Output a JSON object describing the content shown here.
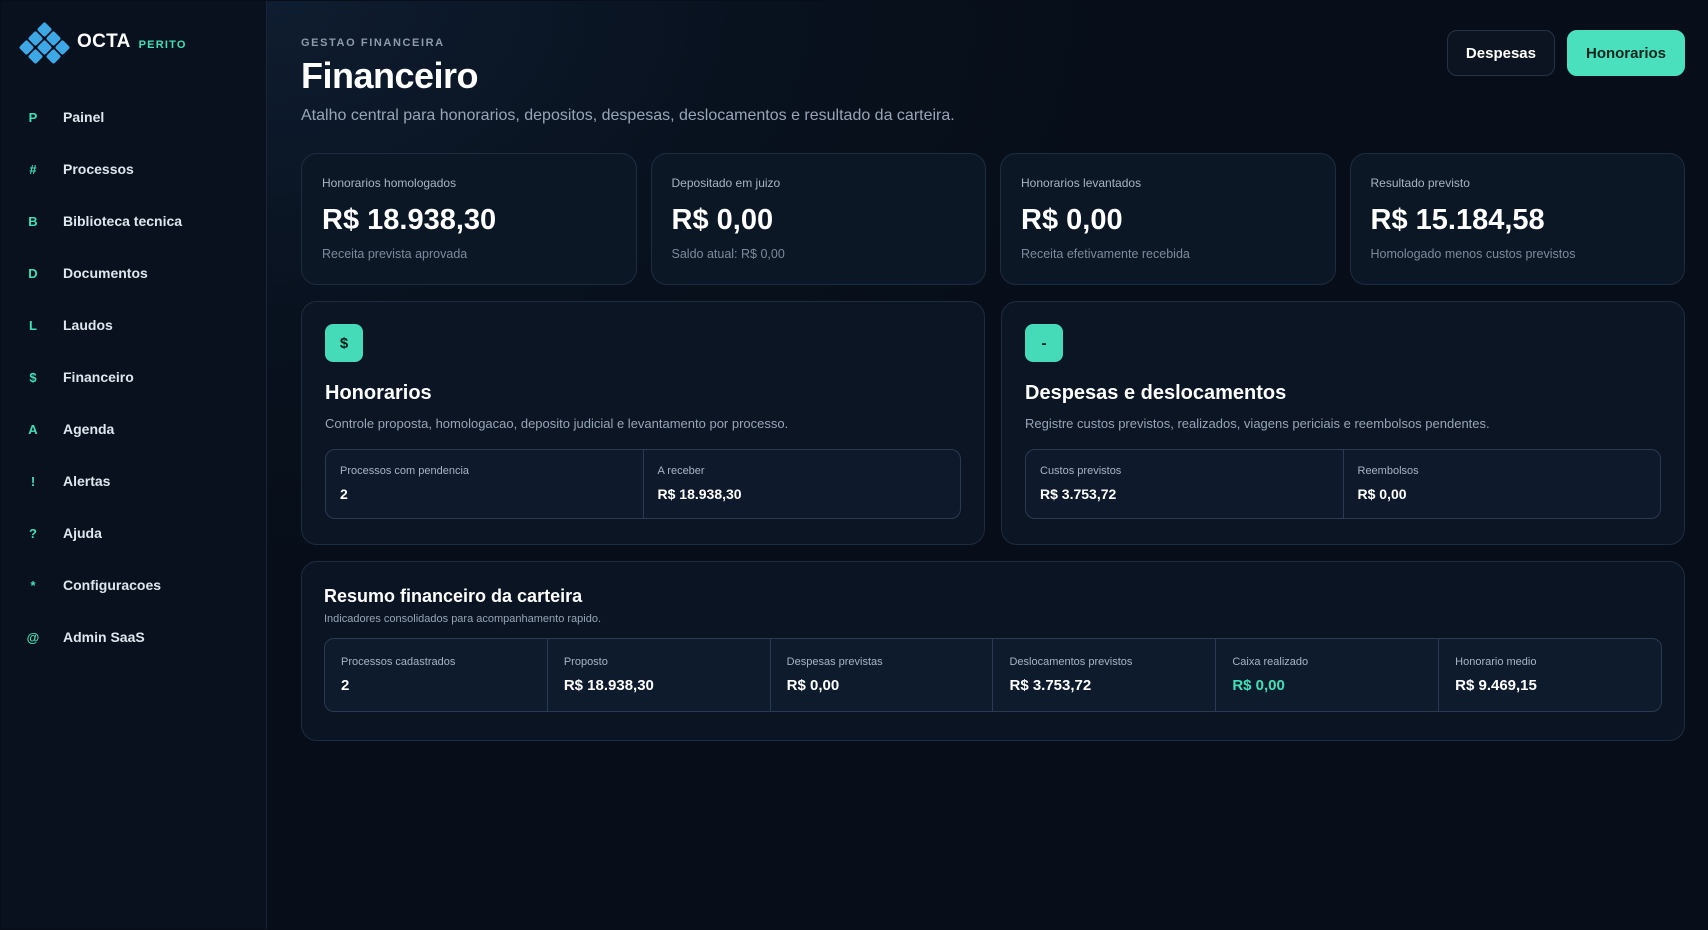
{
  "brand": {
    "name": "OCTA",
    "tag": "PERITO"
  },
  "sidebar": {
    "items": [
      {
        "icon": "P",
        "label": "Painel"
      },
      {
        "icon": "#",
        "label": "Processos"
      },
      {
        "icon": "B",
        "label": "Biblioteca tecnica"
      },
      {
        "icon": "D",
        "label": "Documentos"
      },
      {
        "icon": "L",
        "label": "Laudos"
      },
      {
        "icon": "$",
        "label": "Financeiro"
      },
      {
        "icon": "A",
        "label": "Agenda"
      },
      {
        "icon": "!",
        "label": "Alertas"
      },
      {
        "icon": "?",
        "label": "Ajuda"
      },
      {
        "icon": "*",
        "label": "Configuracoes"
      },
      {
        "icon": "@",
        "label": "Admin SaaS"
      }
    ]
  },
  "header": {
    "eyebrow": "GESTAO FINANCEIRA",
    "title": "Financeiro",
    "subtitle": "Atalho central para honorarios, depositos, despesas, deslocamentos e resultado da carteira.",
    "buttons": {
      "expenses": "Despesas",
      "fees": "Honorarios"
    }
  },
  "stats": [
    {
      "label": "Honorarios homologados",
      "value": "R$ 18.938,30",
      "note": "Receita prevista aprovada"
    },
    {
      "label": "Depositado em juizo",
      "value": "R$ 0,00",
      "note": "Saldo atual: R$ 0,00"
    },
    {
      "label": "Honorarios levantados",
      "value": "R$ 0,00",
      "note": "Receita efetivamente recebida"
    },
    {
      "label": "Resultado previsto",
      "value": "R$ 15.184,58",
      "note": "Homologado menos custos previstos"
    }
  ],
  "panels": {
    "fees": {
      "icon": "$",
      "title": "Honorarios",
      "description": "Controle proposta, homologacao, deposito judicial e levantamento por processo.",
      "metrics": [
        {
          "label": "Processos com pendencia",
          "value": "2"
        },
        {
          "label": "A receber",
          "value": "R$ 18.938,30"
        }
      ]
    },
    "expenses": {
      "icon": "-",
      "title": "Despesas e deslocamentos",
      "description": "Registre custos previstos, realizados, viagens periciais e reembolsos pendentes.",
      "metrics": [
        {
          "label": "Custos previstos",
          "value": "R$ 3.753,72"
        },
        {
          "label": "Reembolsos",
          "value": "R$ 0,00"
        }
      ]
    }
  },
  "summary": {
    "title": "Resumo financeiro da carteira",
    "subtitle": "Indicadores consolidados para acompanhamento rapido.",
    "cells": [
      {
        "label": "Processos cadastrados",
        "value": "2"
      },
      {
        "label": "Proposto",
        "value": "R$ 18.938,30"
      },
      {
        "label": "Despesas previstas",
        "value": "R$ 0,00"
      },
      {
        "label": "Deslocamentos previstos",
        "value": "R$ 3.753,72"
      },
      {
        "label": "Caixa realizado",
        "value": "R$ 0,00"
      },
      {
        "label": "Honorario medio",
        "value": "R$ 9.469,15"
      }
    ]
  },
  "colors": {
    "accent": "#4ae0be",
    "logo": "#3ea7e6",
    "background": "#070e19"
  }
}
